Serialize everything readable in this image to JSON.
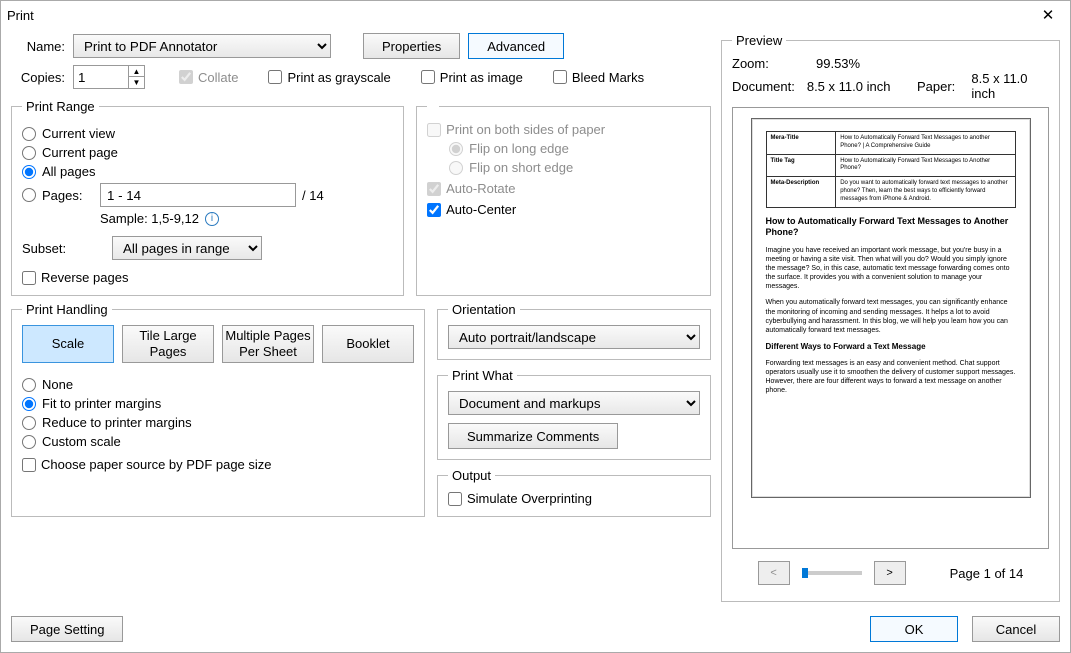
{
  "window": {
    "title": "Print"
  },
  "top": {
    "name_label": "Name:",
    "printer": "Print to PDF Annotator",
    "properties": "Properties",
    "advanced": "Advanced",
    "copies_label": "Copies:",
    "copies_value": "1",
    "collate": "Collate",
    "grayscale": "Print as grayscale",
    "as_image": "Print as image",
    "bleed": "Bleed Marks"
  },
  "range": {
    "legend": "Print Range",
    "current_view": "Current view",
    "current_page": "Current page",
    "all_pages": "All pages",
    "pages": "Pages:",
    "pages_value": "1 - 14",
    "total": "/ 14",
    "sample": "Sample: 1,5-9,12",
    "subset_label": "Subset:",
    "subset_value": "All pages in range",
    "reverse": "Reverse pages"
  },
  "both_sides": {
    "both": "Print on both sides of paper",
    "long": "Flip on long edge",
    "short": "Flip on short edge",
    "autorotate": "Auto-Rotate",
    "autocenter": "Auto-Center"
  },
  "handling": {
    "legend": "Print Handling",
    "scale": "Scale",
    "tile": "Tile Large Pages",
    "multiple": "Multiple Pages Per Sheet",
    "booklet": "Booklet",
    "none": "None",
    "fit": "Fit to printer margins",
    "reduce": "Reduce to printer margins",
    "custom": "Custom scale",
    "paper_source": "Choose paper source by PDF page size"
  },
  "orientation": {
    "legend": "Orientation",
    "value": "Auto portrait/landscape"
  },
  "print_what": {
    "legend": "Print What",
    "value": "Document and markups",
    "summarize": "Summarize Comments"
  },
  "output": {
    "legend": "Output",
    "simulate": "Simulate Overprinting"
  },
  "preview": {
    "legend": "Preview",
    "zoom_label": "Zoom:",
    "zoom_value": "99.53%",
    "doc_label": "Document:",
    "doc_value": "8.5 x 11.0 inch",
    "paper_label": "Paper:",
    "paper_value": "8.5 x 11.0 inch",
    "page_status": "Page 1 of 14"
  },
  "doc": {
    "r1a": "Mera-Title",
    "r1b": "How to Automatically Forward Text Messages to another Phone? | A Comprehensive Guide",
    "r2a": "Title Tag",
    "r2b": "How to Automatically Forward Text Messages to Another Phone?",
    "r3a": "Meta-Description",
    "r3b": "Do you want to automatically forward text messages to another phone? Then, learn the best ways to efficiently forward messages from iPhone & Android.",
    "h1": "How to Automatically Forward Text Messages to Another Phone?",
    "p1": "Imagine you have received an important work message, but you're busy in a meeting or having a site visit. Then what will you do? Would you simply ignore the message? So, in this case, automatic text message forwarding comes onto the surface. It provides you with a convenient solution to manage your messages.",
    "p2": "When you automatically forward text messages, you can significantly enhance the monitoring of incoming and sending messages. It helps a lot to avoid cyberbullying and harassment. In this blog, we will help you learn how you can automatically forward text messages.",
    "h2": "Different Ways to Forward a Text Message",
    "p3": "Forwarding text messages is an easy and convenient method. Chat support operators usually use it to smoothen the delivery of customer support messages. However, there are four different ways to forward a text message on another phone."
  },
  "footer": {
    "page_setting": "Page Setting",
    "ok": "OK",
    "cancel": "Cancel"
  }
}
